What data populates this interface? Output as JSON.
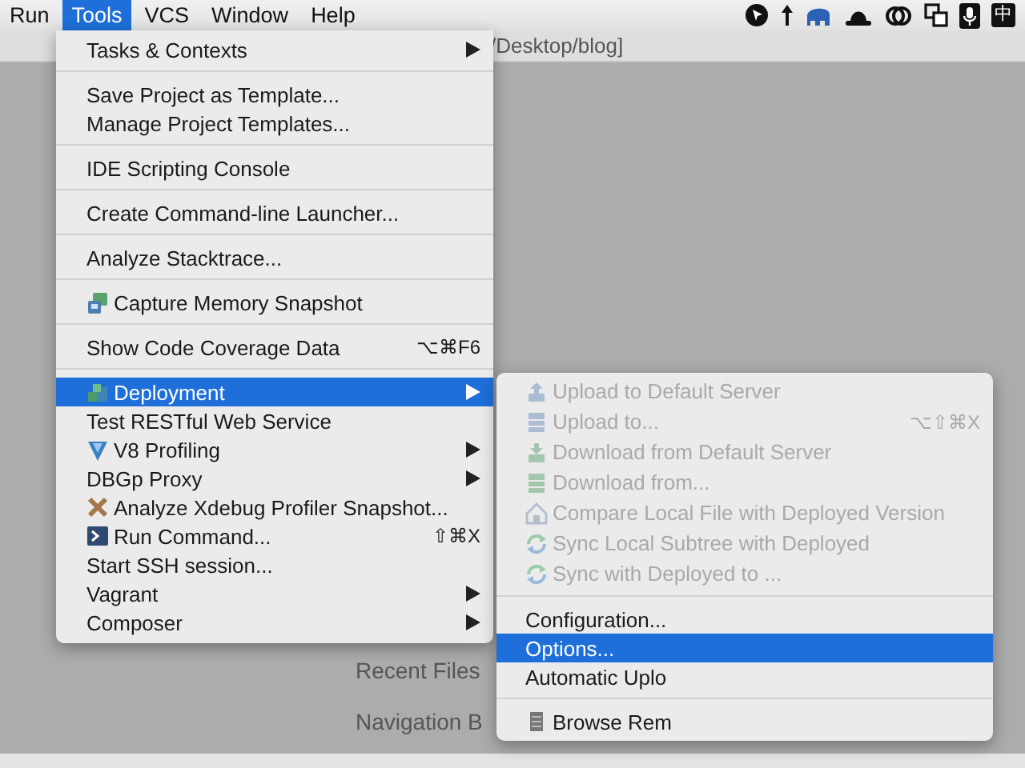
{
  "menubar": {
    "items": [
      {
        "label": "Run",
        "selected": false
      },
      {
        "label": "Tools",
        "selected": true
      },
      {
        "label": "VCS",
        "selected": false
      },
      {
        "label": "Window",
        "selected": false
      },
      {
        "label": "Help",
        "selected": false
      }
    ],
    "input_source": "中"
  },
  "window_title": "/Desktop/blog]",
  "welcome": {
    "items": [
      "Recent Files",
      "Navigation B"
    ]
  },
  "tools_menu": {
    "items": [
      {
        "kind": "item",
        "label": "Tasks & Contexts",
        "selected": false,
        "has_submenu": true
      },
      {
        "kind": "separator"
      },
      {
        "kind": "item",
        "label": "Save Project as Template...",
        "selected": false,
        "has_submenu": false
      },
      {
        "kind": "item",
        "label": "Manage Project Templates...",
        "selected": false,
        "has_submenu": false
      },
      {
        "kind": "separator"
      },
      {
        "kind": "item",
        "label": "IDE Scripting Console",
        "selected": false,
        "has_submenu": false
      },
      {
        "kind": "separator"
      },
      {
        "kind": "item",
        "label": "Create Command-line Launcher...",
        "selected": false,
        "has_submenu": false
      },
      {
        "kind": "separator"
      },
      {
        "kind": "item",
        "label": "Analyze Stacktrace...",
        "selected": false,
        "has_submenu": false
      },
      {
        "kind": "separator"
      },
      {
        "kind": "item",
        "label": "Capture Memory Snapshot",
        "selected": false,
        "has_submenu": false
      },
      {
        "kind": "separator"
      },
      {
        "kind": "item",
        "label": "Show Code Coverage Data",
        "selected": false,
        "has_submenu": false,
        "shortcut": "⌥⌘F6"
      },
      {
        "kind": "separator"
      },
      {
        "kind": "item",
        "label": "Deployment",
        "selected": true,
        "has_submenu": true
      },
      {
        "kind": "item",
        "label": "Test RESTful Web Service",
        "selected": false,
        "has_submenu": false
      },
      {
        "kind": "item",
        "label": "V8 Profiling",
        "selected": false,
        "has_submenu": true
      },
      {
        "kind": "item",
        "label": "DBGp Proxy",
        "selected": false,
        "has_submenu": true
      },
      {
        "kind": "item",
        "label": "Analyze Xdebug Profiler Snapshot...",
        "selected": false,
        "has_submenu": false
      },
      {
        "kind": "item",
        "label": "Run Command...",
        "selected": false,
        "has_submenu": false,
        "shortcut": "⇧⌘X"
      },
      {
        "kind": "item",
        "label": "Start SSH session...",
        "selected": false,
        "has_submenu": false
      },
      {
        "kind": "item",
        "label": "Vagrant",
        "selected": false,
        "has_submenu": true
      },
      {
        "kind": "item",
        "label": "Composer",
        "selected": false,
        "has_submenu": true
      }
    ]
  },
  "deployment_submenu": {
    "items": [
      {
        "kind": "item",
        "label": "Upload to Default Server",
        "selected": false,
        "disabled": true
      },
      {
        "kind": "item",
        "label": "Upload to...",
        "selected": false,
        "disabled": true,
        "shortcut": "⌥⇧⌘X"
      },
      {
        "kind": "item",
        "label": "Download from Default Server",
        "selected": false,
        "disabled": true
      },
      {
        "kind": "item",
        "label": "Download from...",
        "selected": false,
        "disabled": true
      },
      {
        "kind": "item",
        "label": "Compare Local File with Deployed Version",
        "selected": false,
        "disabled": true
      },
      {
        "kind": "item",
        "label": "Sync Local Subtree with Deployed",
        "selected": false,
        "disabled": true
      },
      {
        "kind": "item",
        "label": "Sync with Deployed to ...",
        "selected": false,
        "disabled": true
      },
      {
        "kind": "separator"
      },
      {
        "kind": "item",
        "label": "Configuration...",
        "selected": false,
        "disabled": false
      },
      {
        "kind": "item",
        "label": "Options...",
        "selected": true,
        "disabled": false
      },
      {
        "kind": "item",
        "label": "Automatic Uplo",
        "selected": false,
        "disabled": false
      },
      {
        "kind": "separator"
      },
      {
        "kind": "item",
        "label": "Browse Rem",
        "selected": false,
        "disabled": false
      }
    ]
  }
}
